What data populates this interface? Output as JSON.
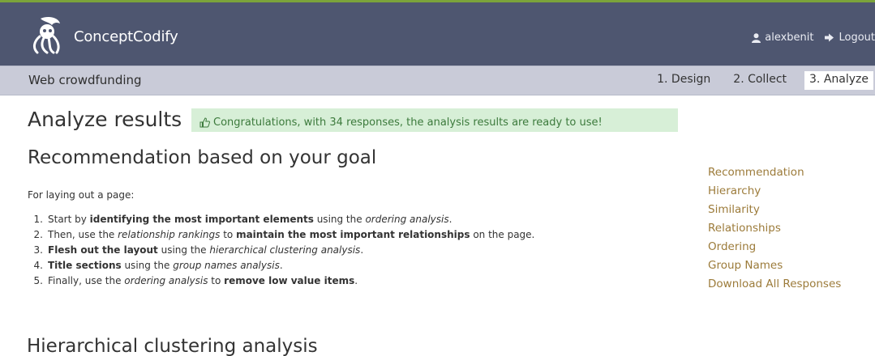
{
  "header": {
    "brand": "ConceptCodify",
    "username": "alexbenit",
    "logout_label": "Logout"
  },
  "subnav": {
    "project_name": "Web crowdfunding",
    "steps": [
      {
        "label": "1. Design"
      },
      {
        "label": "2. Collect"
      },
      {
        "label": "3. Analyze",
        "active": true
      }
    ]
  },
  "main": {
    "title": "Analyze results",
    "alert_text": "Congratulations, with 34 responses, the analysis results are ready to use!",
    "recommendation": {
      "heading": "Recommendation based on your goal",
      "intro": "For laying out a page:",
      "items": [
        {
          "num": "1.",
          "parts": [
            "Start by ",
            "identifying the most important elements",
            " using the ",
            "ordering analysis",
            "."
          ]
        },
        {
          "num": "2.",
          "parts": [
            "Then, use the ",
            "relationship rankings",
            " to ",
            "maintain the most important relationships",
            " on the page."
          ]
        },
        {
          "num": "3.",
          "parts": [
            "Flesh out the layout",
            " using the ",
            "hierarchical clustering analysis",
            "."
          ]
        },
        {
          "num": "4.",
          "parts": [
            "Title sections",
            " using the ",
            "group names analysis",
            "."
          ]
        },
        {
          "num": "5.",
          "parts": [
            "Finally, use the ",
            "ordering analysis",
            " to ",
            "remove low value items",
            "."
          ]
        }
      ]
    },
    "hierarchical_heading": "Hierarchical clustering analysis"
  },
  "sidebar": {
    "links": [
      {
        "label": "Recommendation"
      },
      {
        "label": "Hierarchy"
      },
      {
        "label": "Similarity"
      },
      {
        "label": "Relationships"
      },
      {
        "label": "Ordering"
      },
      {
        "label": "Group Names"
      },
      {
        "label": "Download All Responses"
      }
    ]
  },
  "colors": {
    "navbar": "#4e5670",
    "subbar": "#c9cbd8",
    "alert_bg": "#d7efd7",
    "alert_text": "#3c7a3c",
    "link": "#9c7b3a",
    "top_accent": "#7ba33a"
  },
  "icons": {
    "logo": "octopus-logo-icon",
    "user": "user-icon",
    "logout": "sign-out-icon",
    "alert": "thumbs-up-icon"
  }
}
